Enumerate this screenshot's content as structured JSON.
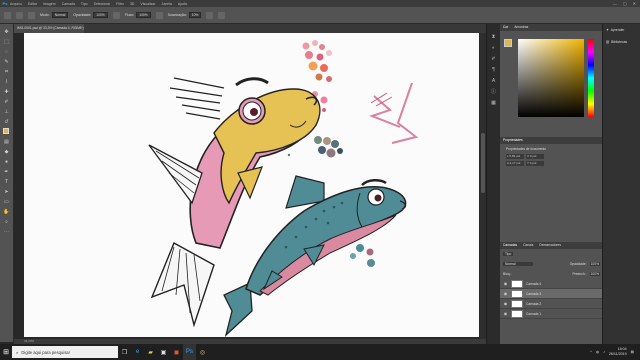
{
  "menubar": {
    "items": [
      "Arquivo",
      "Editar",
      "Imagem",
      "Camada",
      "Tipo",
      "Selecionar",
      "Filtro",
      "3D",
      "Visualizar",
      "Janela",
      "Ajuda"
    ],
    "window_controls": [
      "—",
      "▢",
      "✕"
    ]
  },
  "options": {
    "mode_label": "Modo:",
    "mode_value": "Normal",
    "opacity_label": "Opacidade:",
    "opacity_value": "100%",
    "flow_label": "Fluxo:",
    "flow_value": "100%",
    "smoothing_label": "Suavização:",
    "smoothing_value": "10%"
  },
  "document": {
    "tab_title": "IMG-0001.psd @ 33,3% (Camada 4, RGB/8*)"
  },
  "status": {
    "zoom": "33,33%"
  },
  "panels": {
    "color_tabs": [
      "Cor",
      "Amostras"
    ],
    "learn_title": "Aprender",
    "learn_items": [
      "Aprender",
      "Bibliotecas"
    ],
    "properties_title": "Propriedades",
    "properties_subtitle": "Propriedades de documento",
    "properties_fields": [
      "L 5,83 pol",
      "X 0 pol",
      "A 4,17 pol",
      "Y 0 pol"
    ],
    "layers_tabs": [
      "Camadas",
      "Canais",
      "Demarcadores"
    ],
    "layers_filter": "Tipo",
    "blend_mode": "Normal",
    "opacity_label": "Opacidade:",
    "opacity_value": "100%",
    "fill_label": "Preench.:",
    "fill_value": "100%",
    "lock_label": "Bloq.:",
    "layers": [
      {
        "name": "Camada 4",
        "selected": false
      },
      {
        "name": "Camada 3",
        "selected": true
      },
      {
        "name": "Camada 2",
        "selected": false
      },
      {
        "name": "Camada 1",
        "selected": false
      }
    ]
  },
  "taskbar": {
    "search_placeholder": "Digite aqui para pesquisar",
    "time": "18:04",
    "date": "26/11/2019"
  },
  "colors": {
    "foreground": "#e0b64a",
    "background": "#ffffff",
    "fish1_body": "#e6c154",
    "fish1_belly": "#e69ab6",
    "fish2_body": "#4f8c96",
    "fish2_belly": "#d98aa0"
  }
}
